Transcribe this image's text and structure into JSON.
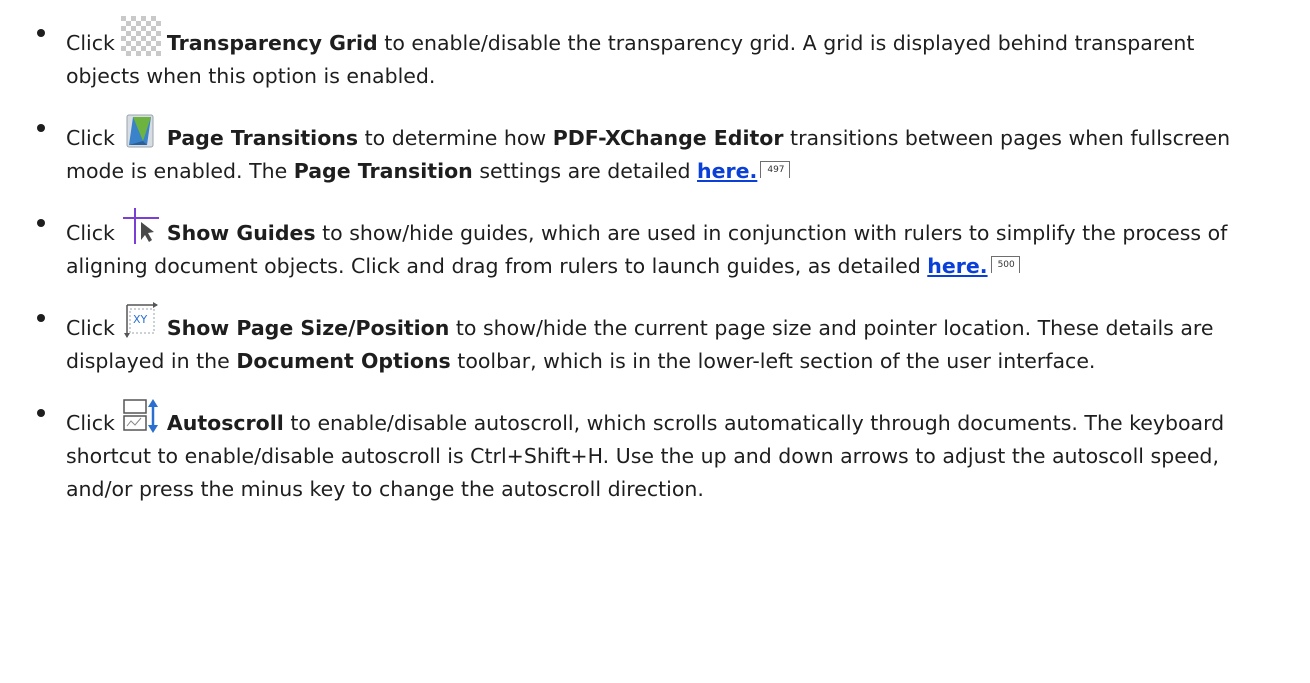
{
  "items": [
    {
      "click": "Click",
      "icon": "transparency-grid-icon",
      "bold_name": "Transparency Grid",
      "text": "to enable/disable the transparency grid. A grid is displayed behind transparent objects when this option is enabled."
    },
    {
      "click": "Click",
      "icon": "page-transitions-icon",
      "bold_name": "Page Transitions",
      "text_a": "to determine how",
      "bold_app": "PDF-XChange Editor",
      "text_b": "transitions between pages when fullscreen mode is enabled. The",
      "bold_settings": "Page Transition",
      "text_c": "settings are detailed",
      "link": "here.",
      "page_ref": "497"
    },
    {
      "click": "Click",
      "icon": "show-guides-icon",
      "bold_name": "Show Guides",
      "text": "to show/hide guides, which are used in conjunction with rulers to simplify the process of aligning document objects. Click and drag from rulers to launch guides, as detailed",
      "link": "here.",
      "page_ref": "500"
    },
    {
      "click": "Click",
      "icon": "show-page-size-position-icon",
      "icon_label": "XY",
      "bold_name": "Show Page Size/Position",
      "text_a": "to show/hide the current page size and pointer location. These details are displayed in the",
      "bold_toolbar": "Document Options",
      "text_b": "toolbar, which is in the lower-left section of the user interface."
    },
    {
      "click": "Click",
      "icon": "autoscroll-icon",
      "bold_name": "Autoscroll",
      "text": "to enable/disable autoscroll, which scrolls automatically through documents. The keyboard shortcut to enable/disable autoscroll is Ctrl+Shift+H. Use the up and down arrows to adjust the autoscoll speed, and/or press the minus key to change the autoscroll direction."
    }
  ],
  "colors": {
    "text": "#1e1e1e",
    "link": "#0b40d8",
    "guide_line": "#7b3fd6",
    "pointer": "#4a4a4a",
    "autoscroll_arrow": "#2a6fd0"
  }
}
